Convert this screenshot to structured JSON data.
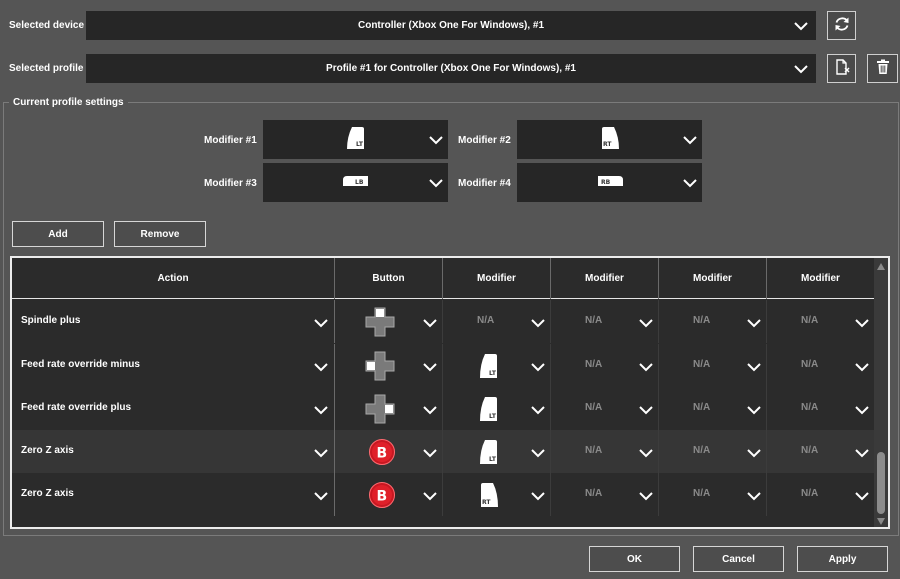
{
  "device": {
    "label": "Selected device",
    "value": "Controller (Xbox One For Windows), #1"
  },
  "profile": {
    "label": "Selected profile",
    "value": "Profile #1 for Controller (Xbox One For Windows), #1"
  },
  "settings": {
    "legend": "Current profile settings",
    "modifiers": [
      {
        "label": "Modifier #1",
        "icon": "LT"
      },
      {
        "label": "Modifier #2",
        "icon": "RT"
      },
      {
        "label": "Modifier #3",
        "icon": "LB"
      },
      {
        "label": "Modifier #4",
        "icon": "RB"
      }
    ]
  },
  "buttons": {
    "add": "Add",
    "remove": "Remove",
    "ok": "OK",
    "cancel": "Cancel",
    "apply": "Apply"
  },
  "table": {
    "headers": [
      "Action",
      "Button",
      "Modifier",
      "Modifier",
      "Modifier",
      "Modifier"
    ],
    "rows": [
      {
        "action": "Spindle plus",
        "button": "dpad-up",
        "modifiers": [
          "N/A",
          "N/A",
          "N/A",
          "N/A"
        ]
      },
      {
        "action": "Feed rate override minus",
        "button": "dpad-left",
        "modifiers": [
          "LT",
          "N/A",
          "N/A",
          "N/A"
        ]
      },
      {
        "action": "Feed rate override plus",
        "button": "dpad-right",
        "modifiers": [
          "LT",
          "N/A",
          "N/A",
          "N/A"
        ]
      },
      {
        "action": "Zero Z axis",
        "button": "B",
        "modifiers": [
          "LT",
          "N/A",
          "N/A",
          "N/A"
        ]
      },
      {
        "action": "Zero Z axis",
        "button": "B",
        "modifiers": [
          "RT",
          "N/A",
          "N/A",
          "N/A"
        ]
      }
    ]
  },
  "colors": {
    "background": "#555555",
    "combo": "#262626",
    "table": "#2b2b2b",
    "b_button": "#e0202a"
  },
  "icons": {
    "refresh": "refresh-icon",
    "new_profile": "new-profile-icon",
    "delete": "trash-icon"
  }
}
